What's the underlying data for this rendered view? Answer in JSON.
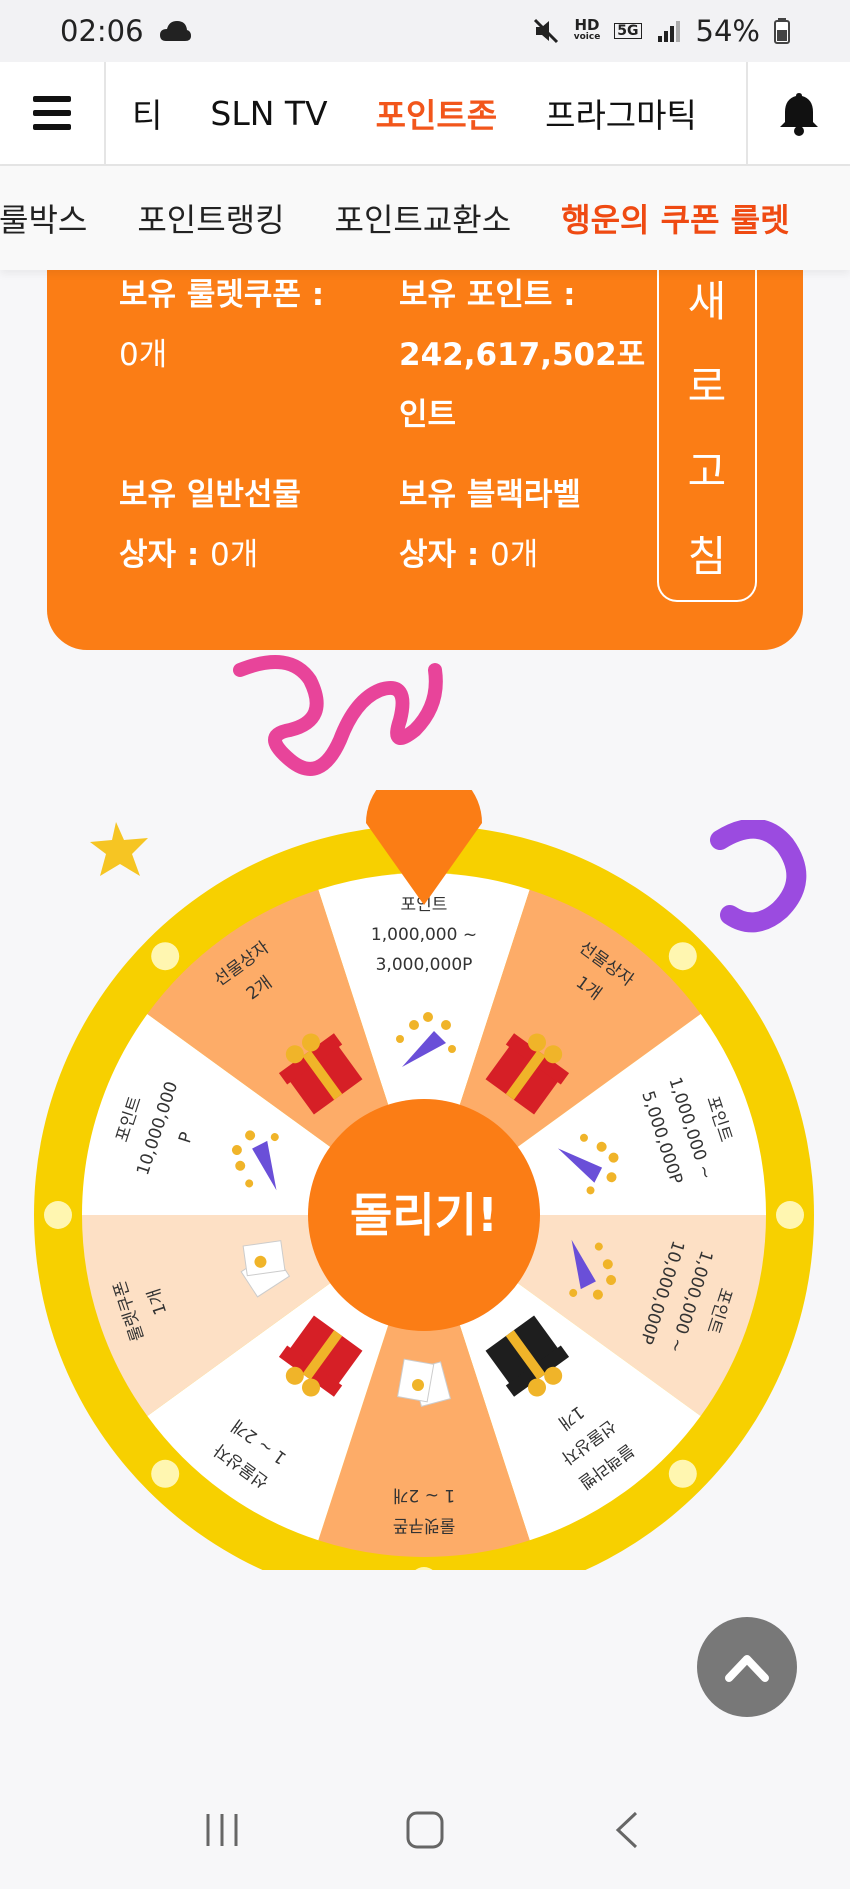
{
  "status": {
    "time": "02:06",
    "battery": "54%",
    "hd_top": "HD",
    "hd_bottom": "voice",
    "net": "5G"
  },
  "nav": {
    "items": [
      "티",
      "SLN TV",
      "포인트존",
      "프라그마틱"
    ],
    "active_index": 2
  },
  "subnav": {
    "items": [
      "룰박스",
      "포인트랭킹",
      "포인트교환소",
      "행운의 쿠폰 룰렛"
    ],
    "active_index": 3
  },
  "card": {
    "coupon_label": "보유 룰렛쿠폰 :",
    "coupon_value": "0개",
    "points_label": "보유 포인트 :",
    "points_value_line1": "242,617,502포",
    "points_value_line2": "인트",
    "gift_label_line1": "보유 일반선물",
    "gift_label_line2": "상자 : ",
    "gift_value": "0개",
    "black_label_line1": "보유 블랙라벨",
    "black_label_line2": "상자 : ",
    "black_value": "0개",
    "refresh_chars": [
      "새",
      "로",
      "고",
      "침"
    ]
  },
  "wheel": {
    "spin_label": "돌리기!",
    "colors": {
      "rim": "#f7d000",
      "pointer": "#fb7d15",
      "hub": "#fb7d15",
      "orange_seg": "#fdac68",
      "light_seg": "#fde0c5",
      "white_seg": "#ffffff"
    },
    "segments": [
      {
        "lines": [
          "포인트",
          "1,000,000 ~",
          "3,000,000P"
        ],
        "fill": "white",
        "icon": "party-popper"
      },
      {
        "lines": [
          "선물상자",
          "1개"
        ],
        "fill": "orange",
        "icon": "gift-box-red"
      },
      {
        "lines": [
          "포인트",
          "1,000,000 ~",
          "5,000,000P"
        ],
        "fill": "white",
        "icon": "party-popper"
      },
      {
        "lines": [
          "포인트",
          "1,000,000 ~",
          "10,000,000P"
        ],
        "fill": "light",
        "icon": "party-popper"
      },
      {
        "lines": [
          "블랙라벨",
          "선물상자",
          "1개"
        ],
        "fill": "white",
        "icon": "gift-box-black"
      },
      {
        "lines": [
          "룰렛쿠폰",
          "1 ~ 2개"
        ],
        "fill": "orange",
        "icon": "coupon-tickets"
      },
      {
        "lines": [
          "선물상자",
          "1 ~ 2개"
        ],
        "fill": "white",
        "icon": "gift-box-red"
      },
      {
        "lines": [
          "룰렛쿠폰",
          "1개"
        ],
        "fill": "light",
        "icon": "coupon-tickets"
      },
      {
        "lines": [
          "포인트",
          "10,000,000",
          "P"
        ],
        "fill": "white",
        "icon": "party-popper"
      },
      {
        "lines": [
          "선물상자",
          "2개"
        ],
        "fill": "orange",
        "icon": "gift-box-red"
      }
    ]
  },
  "icons": {
    "menu": "hamburger-icon",
    "bell": "bell-icon",
    "scroll_top": "chevron-up-icon",
    "recents": "recents-icon",
    "home": "home-icon",
    "back": "back-icon"
  }
}
